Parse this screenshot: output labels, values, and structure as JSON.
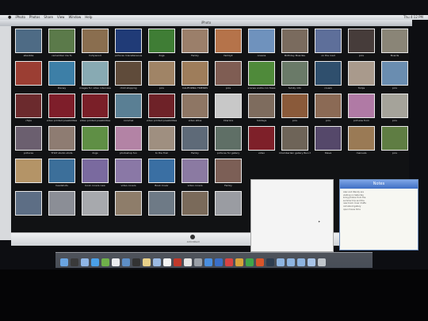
{
  "menubar": {
    "items": [
      "iPhoto",
      "Photos",
      "Share",
      "View",
      "Window",
      "Help"
    ],
    "clock": "Thu 4:12 PM"
  },
  "window": {
    "title": "iPhoto"
  },
  "thumbnails": [
    {
      "caption": "ellenbbs",
      "color": "#4e6b85"
    },
    {
      "caption": "remember me fo",
      "color": "#5b7a4a"
    },
    {
      "caption": "hollywood",
      "color": "#8a6e4f"
    },
    {
      "caption": "pictures miscellaneous",
      "color": "#203b77"
    },
    {
      "caption": "dogs",
      "color": "#3f7d35"
    },
    {
      "caption": "Family",
      "color": "#9b7f6a"
    },
    {
      "caption": "family2",
      "color": "#b5734a"
    },
    {
      "caption": "oceans",
      "color": "#6f92bd"
    },
    {
      "caption": "Birthday Boardes",
      "color": "#7a6b5e"
    },
    {
      "caption": "on the road",
      "color": "#5e6f9a"
    },
    {
      "caption": "pics",
      "color": "#463c3a"
    },
    {
      "caption": "Boards",
      "color": "#8a8577"
    },
    {
      "caption": "",
      "color": "#9b3e33"
    },
    {
      "caption": "Disney",
      "color": "#3d7fa7"
    },
    {
      "caption": "images for video interviews",
      "color": "#88aab3"
    },
    {
      "caption": "child stopping",
      "color": "#5f4b3a"
    },
    {
      "caption": "pics",
      "color": "#a08466"
    },
    {
      "caption": "CALIFORNIA FRIENDS",
      "color": "#9e7d5b"
    },
    {
      "caption": "pics",
      "color": "#7f5d53"
    },
    {
      "caption": "scenes andre con trees",
      "color": "#4f8a3a"
    },
    {
      "caption": "family mtn",
      "color": "#6a7a68"
    },
    {
      "caption": "cousin",
      "color": "#2f4f6d"
    },
    {
      "caption": "Tulips",
      "color": "#a99a8c"
    },
    {
      "caption": "pics",
      "color": "#6a8db0"
    },
    {
      "caption": "chips",
      "color": "#6b2a2d"
    },
    {
      "caption": "video printed possibilities",
      "color": "#7e1e2a"
    },
    {
      "caption": "video printed possibilities",
      "color": "#7a1f28"
    },
    {
      "caption": "cozumel",
      "color": "#5a7f94"
    },
    {
      "caption": "video printed possibilities",
      "color": "#6e2228"
    },
    {
      "caption": "video stilss",
      "color": "#8e7664"
    },
    {
      "caption": "Interiors",
      "color": "#c8c8c8"
    },
    {
      "caption": "holidays",
      "color": "#7e6c5e"
    },
    {
      "caption": "pics",
      "color": "#8a5a3a"
    },
    {
      "caption": "pics",
      "color": "#8b6a55"
    },
    {
      "caption": "pictures from",
      "color": "#b07aa5"
    },
    {
      "caption": "pics",
      "color": "#a5a39a"
    },
    {
      "caption": "pictures",
      "color": "#6b5f6f"
    },
    {
      "caption": "THAT studio shots",
      "color": "#8e7c72"
    },
    {
      "caption": "dogs",
      "color": "#5f8f45"
    },
    {
      "caption": "photoshop fun",
      "color": "#b383a5"
    },
    {
      "caption": "to the Trail",
      "color": "#9f8f80"
    },
    {
      "caption": "Family",
      "color": "#5e6a78"
    },
    {
      "caption": "pictures for gallery",
      "color": "#5f6f66"
    },
    {
      "caption": "video",
      "color": "#7e2029"
    },
    {
      "caption": "Chamberlain gallery Bunch",
      "color": "#6e6458"
    },
    {
      "caption": "Steve",
      "color": "#55486a"
    },
    {
      "caption": "manuals",
      "color": "#9a7a55"
    },
    {
      "caption": "pics",
      "color": "#5f7d43"
    },
    {
      "caption": "",
      "color": "#b49467"
    },
    {
      "caption": "headshots",
      "color": "#3c6f9a"
    },
    {
      "caption": "book covers new",
      "color": "#7a6a9f"
    },
    {
      "caption": "video covers",
      "color": "#8a78a6"
    },
    {
      "caption": "Book Cover",
      "color": "#3a6fa3"
    },
    {
      "caption": "video covers",
      "color": "#8b7aa2"
    },
    {
      "caption": "Family",
      "color": "#7c5f56"
    },
    {
      "caption": "",
      "color": "#1a1a1a"
    },
    {
      "caption": "",
      "color": "#1a1a1a"
    },
    {
      "caption": "",
      "color": "#1a1a1a"
    },
    {
      "caption": "",
      "color": "#1a1a1a"
    },
    {
      "caption": "",
      "color": "#1a1a1a"
    },
    {
      "caption": "",
      "color": "#5d6e85"
    },
    {
      "caption": "",
      "color": "#8b8e96"
    },
    {
      "caption": "",
      "color": "#a7a9ad"
    },
    {
      "caption": "",
      "color": "#8e7d6a"
    },
    {
      "caption": "",
      "color": "#6e7a86"
    },
    {
      "caption": "",
      "color": "#7a6a5a"
    },
    {
      "caption": "",
      "color": "#9a9ca2"
    },
    {
      "caption": "",
      "color": "#1a1a1a"
    },
    {
      "caption": "",
      "color": "#1a1a1a"
    },
    {
      "caption": "",
      "color": "#1a1a1a"
    },
    {
      "caption": "",
      "color": "#1a1a1a"
    },
    {
      "caption": "",
      "color": "#1a1a1a"
    }
  ],
  "bottom_bar": {
    "label": "Add Album"
  },
  "notes": {
    "title": "Notes",
    "lines": [
      "Alex and Wendy are",
      "visiting on Saturday",
      "bring photos from the",
      "summer trip and the",
      "new book cover drafts",
      "call about gallery",
      "open house time"
    ]
  },
  "dock": {
    "icons": [
      {
        "name": "finder-icon",
        "color": "#6aa4e0"
      },
      {
        "name": "dashboard-icon",
        "color": "#3a3a3a"
      },
      {
        "name": "mail-icon",
        "color": "#8fb6e6"
      },
      {
        "name": "safari-icon",
        "color": "#4aa0e8"
      },
      {
        "name": "itunes-icon",
        "color": "#6fb04a"
      },
      {
        "name": "ical-icon",
        "color": "#e9ebef"
      },
      {
        "name": "iphoto-icon",
        "color": "#5e8fc7"
      },
      {
        "name": "aperture-icon",
        "color": "#333"
      },
      {
        "name": "notes-icon",
        "color": "#e8d18a"
      },
      {
        "name": "preview-icon",
        "color": "#9cbbe4"
      },
      {
        "name": "calendar-icon",
        "color": "#f4f4f4"
      },
      {
        "name": "photo-booth-icon",
        "color": "#c0392b"
      },
      {
        "name": "textedit-icon",
        "color": "#e6e6e6"
      },
      {
        "name": "system-preferences-icon",
        "color": "#9aa0a8"
      },
      {
        "name": "app-store-icon",
        "color": "#4a8fe0"
      },
      {
        "name": "word-icon",
        "color": "#3a6fc8"
      },
      {
        "name": "help-icon",
        "color": "#d84343"
      },
      {
        "name": "flash-icon",
        "color": "#d8a43a"
      },
      {
        "name": "excel-icon",
        "color": "#3fa64a"
      },
      {
        "name": "powerpoint-icon",
        "color": "#d9552a"
      },
      {
        "name": "lightroom-icon",
        "color": "#2e3d4f"
      },
      {
        "name": "folder-icon",
        "color": "#8eb4e0"
      },
      {
        "name": "folder-icon",
        "color": "#8eb4e0"
      },
      {
        "name": "folder-icon",
        "color": "#8eb4e0"
      },
      {
        "name": "documents-icon",
        "color": "#a8c4e8"
      },
      {
        "name": "trash-icon",
        "color": "#c0c6cc"
      }
    ]
  }
}
